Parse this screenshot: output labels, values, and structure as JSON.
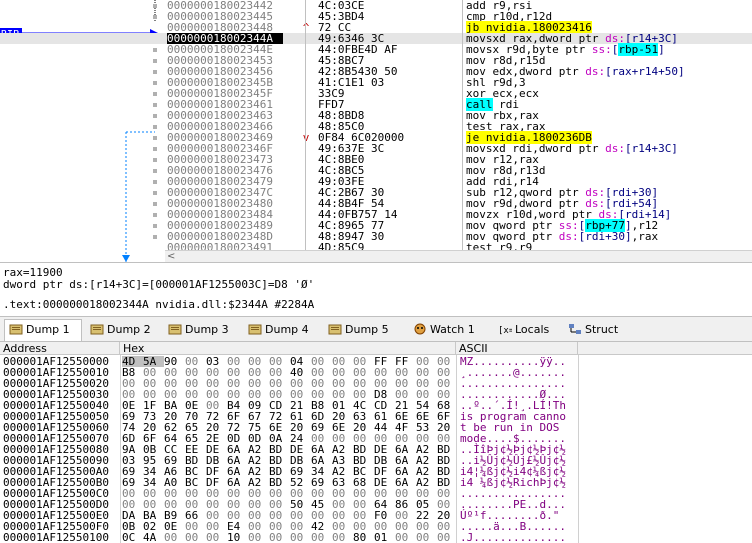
{
  "disasm": {
    "rip_label": "RIP",
    "lines": [
      {
        "addr": "0000000180023442",
        "arrow": "",
        "bytes": "4C:03CE",
        "instr": [
          {
            "t": "add r9,rsi"
          }
        ]
      },
      {
        "addr": "0000000180023445",
        "arrow": "",
        "bytes": "45:3BD4",
        "instr": [
          {
            "t": "cmp r10d,r12d"
          }
        ]
      },
      {
        "addr": "0000000180023448",
        "arrow": "^",
        "bytes": "72 CC",
        "instr": [
          {
            "t": "jb nvidia.180023416",
            "h": "y"
          }
        ]
      },
      {
        "addr": "000000018002344A",
        "arrow": "",
        "bytes": "49:6346 3C",
        "instr": [
          {
            "t": "movsxd rax,dword ptr "
          },
          {
            "t": "ds:",
            "c": "seg"
          },
          {
            "t": "[r14+3C]",
            "c": "mem"
          }
        ],
        "current": true
      },
      {
        "addr": "000000018002344E",
        "arrow": "",
        "bytes": "44:0FBE4D AF",
        "instr": [
          {
            "t": "movsx r9d,byte ptr "
          },
          {
            "t": "ss:",
            "c": "seg"
          },
          {
            "t": "[",
            "c": "mem"
          },
          {
            "t": "rbp-51",
            "h": "c"
          },
          {
            "t": "]",
            "c": "mem"
          }
        ]
      },
      {
        "addr": "0000000180023453",
        "arrow": "",
        "bytes": "45:8BC7",
        "instr": [
          {
            "t": "mov r8d,r15d"
          }
        ]
      },
      {
        "addr": "0000000180023456",
        "arrow": "",
        "bytes": "42:8B5430 50",
        "instr": [
          {
            "t": "mov edx,dword ptr "
          },
          {
            "t": "ds:",
            "c": "seg"
          },
          {
            "t": "[rax+r14+50]",
            "c": "mem"
          }
        ]
      },
      {
        "addr": "000000018002345B",
        "arrow": "",
        "bytes": "41:C1E1 03",
        "instr": [
          {
            "t": "shl r9d,3"
          }
        ]
      },
      {
        "addr": "000000018002345F",
        "arrow": "",
        "bytes": "33C9",
        "instr": [
          {
            "t": "xor ecx,ecx"
          }
        ]
      },
      {
        "addr": "0000000180023461",
        "arrow": "",
        "bytes": "FFD7",
        "instr": [
          {
            "t": "call",
            "h": "c"
          },
          {
            "t": " rdi"
          }
        ]
      },
      {
        "addr": "0000000180023463",
        "arrow": "",
        "bytes": "48:8BD8",
        "instr": [
          {
            "t": "mov rbx,rax"
          }
        ]
      },
      {
        "addr": "0000000180023466",
        "arrow": "",
        "bytes": "48:85C0",
        "instr": [
          {
            "t": "test rax,rax"
          }
        ]
      },
      {
        "addr": "0000000180023469",
        "arrow": "v",
        "bytes": "0F84 6C020000",
        "instr": [
          {
            "t": "je nvidia.1800236DB",
            "h": "y"
          }
        ]
      },
      {
        "addr": "000000018002346F",
        "arrow": "",
        "bytes": "49:637E 3C",
        "instr": [
          {
            "t": "movsxd rdi,dword ptr "
          },
          {
            "t": "ds:",
            "c": "seg"
          },
          {
            "t": "[r14+3C]",
            "c": "mem"
          }
        ]
      },
      {
        "addr": "0000000180023473",
        "arrow": "",
        "bytes": "4C:8BE0",
        "instr": [
          {
            "t": "mov r12,rax"
          }
        ]
      },
      {
        "addr": "0000000180023476",
        "arrow": "",
        "bytes": "4C:8BC5",
        "instr": [
          {
            "t": "mov r8d,r13d"
          }
        ]
      },
      {
        "addr": "0000000180023479",
        "arrow": "",
        "bytes": "49:03FE",
        "instr": [
          {
            "t": "add rdi,r14"
          }
        ]
      },
      {
        "addr": "000000018002347C",
        "arrow": "",
        "bytes": "4C:2B67 30",
        "instr": [
          {
            "t": "sub r12,qword ptr "
          },
          {
            "t": "ds:",
            "c": "seg"
          },
          {
            "t": "[rdi+30]",
            "c": "mem"
          }
        ]
      },
      {
        "addr": "0000000180023480",
        "arrow": "",
        "bytes": "44:8B4F 54",
        "instr": [
          {
            "t": "mov r9d,dword ptr "
          },
          {
            "t": "ds:",
            "c": "seg"
          },
          {
            "t": "[rdi+54]",
            "c": "mem"
          }
        ]
      },
      {
        "addr": "0000000180023484",
        "arrow": "",
        "bytes": "44:0FB757 14",
        "instr": [
          {
            "t": "movzx r10d,word ptr "
          },
          {
            "t": "ds:",
            "c": "seg"
          },
          {
            "t": "[rdi+14]",
            "c": "mem"
          }
        ]
      },
      {
        "addr": "0000000180023489",
        "arrow": "",
        "bytes": "4C:8965 77",
        "instr": [
          {
            "t": "mov qword ptr "
          },
          {
            "t": "ss:",
            "c": "seg"
          },
          {
            "t": "[",
            "c": "mem"
          },
          {
            "t": "rbp+77",
            "h": "c"
          },
          {
            "t": "]",
            "c": "mem"
          },
          {
            "t": ",r12"
          }
        ]
      },
      {
        "addr": "000000018002348D",
        "arrow": "",
        "bytes": "48:8947 30",
        "instr": [
          {
            "t": "mov qword ptr "
          },
          {
            "t": "ds:",
            "c": "seg"
          },
          {
            "t": "[rdi+30]",
            "c": "mem"
          },
          {
            "t": ",rax"
          }
        ]
      },
      {
        "addr": "0000000180023491",
        "arrow": "",
        "bytes": "4D:85C9",
        "instr": [
          {
            "t": "test r9,r9"
          }
        ]
      }
    ]
  },
  "info": {
    "line1": "rax=11900",
    "line2": "dword ptr ds:[r14+3C]=[000001AF1255003C]=D8 'Ø'",
    "line3": ".text:000000018002344A nvidia.dll:$2344A #2284A"
  },
  "tabs": [
    {
      "label": "Dump 1",
      "icon": "dump-icon",
      "active": true
    },
    {
      "label": "Dump 2",
      "icon": "dump-icon"
    },
    {
      "label": "Dump 3",
      "icon": "dump-icon"
    },
    {
      "label": "Dump 4",
      "icon": "dump-icon"
    },
    {
      "label": "Dump 5",
      "icon": "dump-icon"
    },
    {
      "label": "Watch 1",
      "icon": "watch-icon"
    },
    {
      "label": "Locals",
      "icon": "locals-icon"
    },
    {
      "label": "Struct",
      "icon": "struct-icon"
    }
  ],
  "dump": {
    "headers": {
      "address": "Address",
      "hex": "Hex",
      "ascii": "ASCII"
    },
    "rows": [
      {
        "addr": "000001AF12550000",
        "hex": [
          "4D",
          "5A",
          "90",
          "00",
          "03",
          "00",
          "00",
          "00",
          "04",
          "00",
          "00",
          "00",
          "FF",
          "FF",
          "00",
          "00"
        ],
        "ascii": "MZ..........ÿÿ.."
      },
      {
        "addr": "000001AF12550010",
        "hex": [
          "B8",
          "00",
          "00",
          "00",
          "00",
          "00",
          "00",
          "00",
          "40",
          "00",
          "00",
          "00",
          "00",
          "00",
          "00",
          "00"
        ],
        "ascii": "¸.......@......."
      },
      {
        "addr": "000001AF12550020",
        "hex": [
          "00",
          "00",
          "00",
          "00",
          "00",
          "00",
          "00",
          "00",
          "00",
          "00",
          "00",
          "00",
          "00",
          "00",
          "00",
          "00"
        ],
        "ascii": "................"
      },
      {
        "addr": "000001AF12550030",
        "hex": [
          "00",
          "00",
          "00",
          "00",
          "00",
          "00",
          "00",
          "00",
          "00",
          "00",
          "00",
          "00",
          "D8",
          "00",
          "00",
          "00"
        ],
        "ascii": "............Ø..."
      },
      {
        "addr": "000001AF12550040",
        "hex": [
          "0E",
          "1F",
          "BA",
          "0E",
          "00",
          "B4",
          "09",
          "CD",
          "21",
          "B8",
          "01",
          "4C",
          "CD",
          "21",
          "54",
          "68"
        ],
        "ascii": "..º..´.Í!¸.LÍ!Th"
      },
      {
        "addr": "000001AF12550050",
        "hex": [
          "69",
          "73",
          "20",
          "70",
          "72",
          "6F",
          "67",
          "72",
          "61",
          "6D",
          "20",
          "63",
          "61",
          "6E",
          "6E",
          "6F"
        ],
        "ascii": "is program canno"
      },
      {
        "addr": "000001AF12550060",
        "hex": [
          "74",
          "20",
          "62",
          "65",
          "20",
          "72",
          "75",
          "6E",
          "20",
          "69",
          "6E",
          "20",
          "44",
          "4F",
          "53",
          "20"
        ],
        "ascii": "t be run in DOS "
      },
      {
        "addr": "000001AF12550070",
        "hex": [
          "6D",
          "6F",
          "64",
          "65",
          "2E",
          "0D",
          "0D",
          "0A",
          "24",
          "00",
          "00",
          "00",
          "00",
          "00",
          "00",
          "00"
        ],
        "ascii": "mode....$......."
      },
      {
        "addr": "000001AF12550080",
        "hex": [
          "9A",
          "0B",
          "CC",
          "EE",
          "DE",
          "6A",
          "A2",
          "BD",
          "DE",
          "6A",
          "A2",
          "BD",
          "DE",
          "6A",
          "A2",
          "BD"
        ],
        "ascii": "..ÌîÞj¢½Þj¢½Þj¢½"
      },
      {
        "addr": "000001AF12550090",
        "hex": [
          "03",
          "95",
          "69",
          "BD",
          "DB",
          "6A",
          "A2",
          "BD",
          "DB",
          "6A",
          "A3",
          "BD",
          "DB",
          "6A",
          "A2",
          "BD"
        ],
        "ascii": "..i½Ûj¢½Ûj£½Ûj¢½"
      },
      {
        "addr": "000001AF125500A0",
        "hex": [
          "69",
          "34",
          "A6",
          "BC",
          "DF",
          "6A",
          "A2",
          "BD",
          "69",
          "34",
          "A2",
          "BC",
          "DF",
          "6A",
          "A2",
          "BD"
        ],
        "ascii": "i4¦¼ßj¢½i4¢¼ßj¢½"
      },
      {
        "addr": "000001AF125500B0",
        "hex": [
          "69",
          "34",
          "A0",
          "BC",
          "DF",
          "6A",
          "A2",
          "BD",
          "52",
          "69",
          "63",
          "68",
          "DE",
          "6A",
          "A2",
          "BD"
        ],
        "ascii": "i4 ¼ßj¢½RichÞj¢½"
      },
      {
        "addr": "000001AF125500C0",
        "hex": [
          "00",
          "00",
          "00",
          "00",
          "00",
          "00",
          "00",
          "00",
          "00",
          "00",
          "00",
          "00",
          "00",
          "00",
          "00",
          "00"
        ],
        "ascii": "................"
      },
      {
        "addr": "000001AF125500D0",
        "hex": [
          "00",
          "00",
          "00",
          "00",
          "00",
          "00",
          "00",
          "00",
          "50",
          "45",
          "00",
          "00",
          "64",
          "86",
          "05",
          "00"
        ],
        "ascii": "........PE..d..."
      },
      {
        "addr": "000001AF125500E0",
        "hex": [
          "DA",
          "BA",
          "B9",
          "66",
          "00",
          "00",
          "00",
          "00",
          "00",
          "00",
          "00",
          "00",
          "F0",
          "00",
          "22",
          "20"
        ],
        "ascii": "Úº¹f........ð.\" "
      },
      {
        "addr": "000001AF125500F0",
        "hex": [
          "0B",
          "02",
          "0E",
          "00",
          "00",
          "E4",
          "00",
          "00",
          "00",
          "42",
          "00",
          "00",
          "00",
          "00",
          "00",
          "00"
        ],
        "ascii": ".....ä...B......"
      },
      {
        "addr": "000001AF12550100",
        "hex": [
          "0C",
          "4A",
          "00",
          "00",
          "00",
          "10",
          "00",
          "00",
          "00",
          "00",
          "00",
          "80",
          "01",
          "00",
          "00",
          "00"
        ],
        "ascii": ".J.............."
      }
    ]
  }
}
